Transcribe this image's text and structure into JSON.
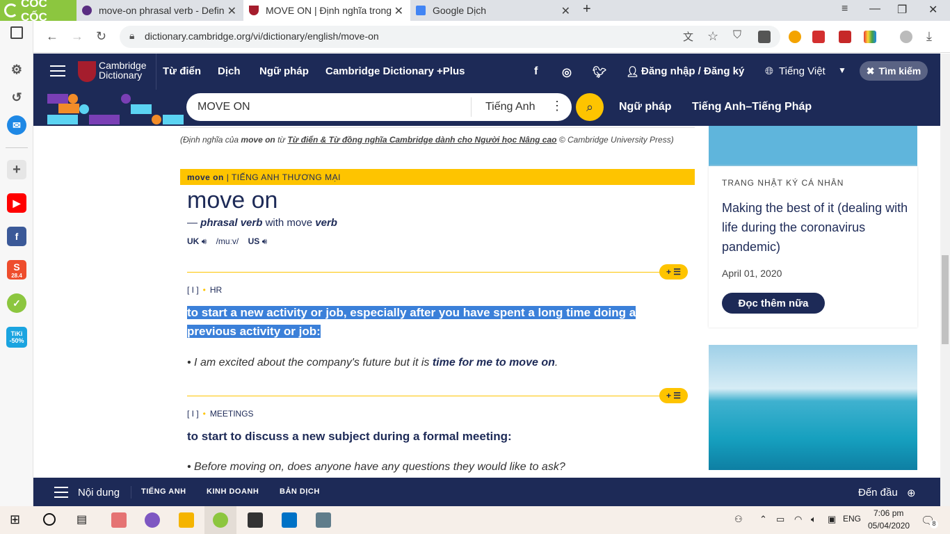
{
  "browser": {
    "brand": "CỐC CỐC",
    "tabs": [
      {
        "title": "move-on phrasal verb - Defin",
        "icon": "oxford-icon"
      },
      {
        "title": "MOVE ON | Định nghĩa trong",
        "icon": "cambridge-icon"
      },
      {
        "title": "Google Dịch",
        "icon": "google-translate-icon"
      }
    ],
    "url": "dictionary.cambridge.org/vi/dictionary/english/move-on"
  },
  "site": {
    "brand_line1": "Cambridge",
    "brand_line2": "Dictionary",
    "nav": [
      "Từ điển",
      "Dịch",
      "Ngữ pháp",
      "Cambridge Dictionary +Plus"
    ],
    "login": "Đăng nhập / Đăng ký",
    "language": "Tiếng Việt",
    "search_toggle": "Tìm kiếm",
    "search_query": "MOVE ON",
    "search_lang": "Tiếng Anh",
    "quick_links": [
      "Ngữ pháp",
      "Tiếng Anh–Tiếng Pháp"
    ]
  },
  "entry": {
    "credit_prefix": "(Định nghĩa của",
    "credit_word": "move on",
    "credit_from": "từ",
    "credit_source": "Từ điển & Từ đồng nghĩa Cambridge dành cho Người học Nâng cao",
    "credit_suffix": "© Cambridge University Press)",
    "band_word": "move on",
    "band_label": "| TIẾNG ANH THƯƠNG MẠI",
    "headword": "move on",
    "pos_dash": "—",
    "pos": "phrasal verb",
    "pos_with": "with move",
    "pos_verb": "verb",
    "uk": "UK",
    "us": "US",
    "ipa": "/muːv/",
    "plus_label": "+ ☰",
    "senses": [
      {
        "gram": "[ I ]",
        "domain": "HR",
        "definition_l1": "to start a new activity or job, especially after you have spent a long time doing a",
        "definition_l2": "previous activity or job:",
        "example_pre": "I am excited about the company's future but it is",
        "example_bold": "time for me to move on",
        "example_post": "."
      },
      {
        "gram": "[ I ]",
        "domain": "MEETINGS",
        "definition": "to start to discuss a new subject during a formal meeting:",
        "example": "Before moving on, does anyone have any questions they would like to ask?"
      }
    ]
  },
  "sidebar_card": {
    "kicker": "TRANG NHẬT KÝ CÁ NHÂN",
    "title": "Making the best of it (dealing with life during the coronavirus pandemic)",
    "date": "April 01, 2020",
    "button": "Đọc thêm nữa"
  },
  "bottom_bar": {
    "toc": "Nội dung",
    "sections": [
      "TIẾNG ANH",
      "KINH DOANH",
      "BẢN DỊCH"
    ],
    "top": "Đến đầu"
  },
  "taskbar": {
    "lang": "ENG",
    "time": "7:06 pm",
    "date": "05/04/2020",
    "notif_count": "8"
  },
  "sidebar_badges": {
    "tiki": "TiKi -50%",
    "shopee_date": "28.4"
  },
  "colors": {
    "navy": "#1d2a57",
    "yellow": "#fec400",
    "highlight": "#3b80d9"
  }
}
